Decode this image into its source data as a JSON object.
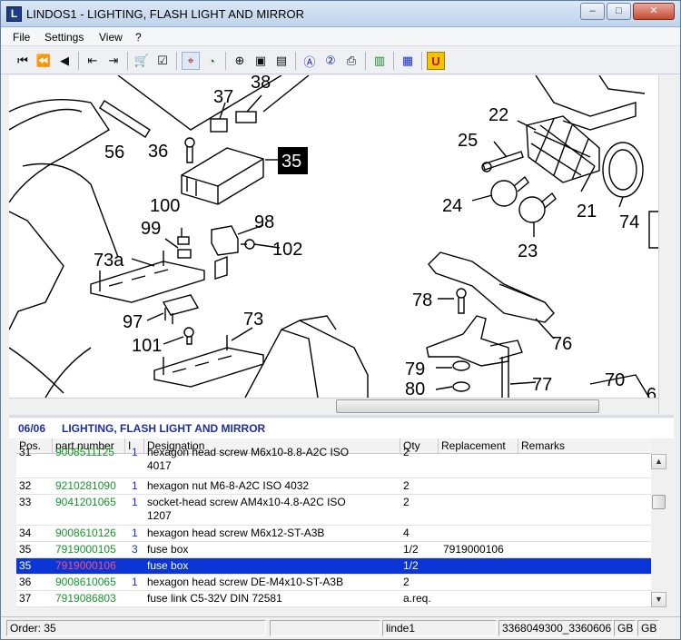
{
  "window": {
    "title": "LINDOS1 - LIGHTING, FLASH LIGHT AND MIRROR",
    "app_icon_glyph": "L",
    "minimize_glyph": "–",
    "maximize_glyph": "□",
    "close_glyph": "✕"
  },
  "menu": {
    "items": [
      "File",
      "Settings",
      "View",
      "?"
    ]
  },
  "toolbar": {
    "buttons": [
      {
        "icon": "first-page-icon",
        "glyph": "⏮"
      },
      {
        "icon": "fast-back-icon",
        "glyph": "⏪"
      },
      {
        "icon": "back-icon",
        "glyph": "◀"
      },
      {
        "icon": "jump-back-icon",
        "glyph": "⇤"
      },
      {
        "icon": "jump-forward-icon",
        "glyph": "⇥"
      },
      {
        "icon": "cart-icon",
        "glyph": "🛒"
      },
      {
        "icon": "order-list-icon",
        "glyph": "☑"
      },
      {
        "icon": "hotspot-icon",
        "glyph": "⌖"
      },
      {
        "icon": "chart-icon",
        "glyph": "◔"
      },
      {
        "icon": "zoom-icon",
        "glyph": "⊕"
      },
      {
        "icon": "fit-page-icon",
        "glyph": "▣"
      },
      {
        "icon": "fit-width-icon",
        "glyph": "▤"
      },
      {
        "icon": "find-a-icon",
        "glyph": "Ⓐ"
      },
      {
        "icon": "find-2-icon",
        "glyph": "②"
      },
      {
        "icon": "print-icon",
        "glyph": "⎙"
      },
      {
        "icon": "book-icon",
        "glyph": "▥"
      },
      {
        "icon": "grid-icon",
        "glyph": "▦"
      },
      {
        "icon": "u-icon",
        "glyph": "U"
      }
    ]
  },
  "drawing": {
    "callouts": [
      "37",
      "38",
      "56",
      "36",
      "35",
      "100",
      "99",
      "98",
      "102",
      "73a",
      "97",
      "101",
      "73",
      "22",
      "25",
      "24",
      "21",
      "74",
      "23",
      "78",
      "76",
      "79",
      "77",
      "80",
      "70",
      "6"
    ],
    "highlight": "35"
  },
  "parts": {
    "code": "06/06",
    "title": "LIGHTING, FLASH LIGHT AND MIRROR",
    "columns": [
      "Pos.",
      "part number",
      "I",
      "Designation",
      "Qty",
      "Replacement",
      "Remarks"
    ],
    "rows": [
      {
        "pos": "31",
        "part": "9008511125",
        "i": "1",
        "desc": [
          "hexagon head screw M6x10-8.8-A2C  ISO",
          "4017"
        ],
        "qty": "2",
        "repl": "",
        "remarks": ""
      },
      {
        "pos": "32",
        "part": "9210281090",
        "i": "1",
        "desc": [
          "hexagon nut M6-8-A2C  ISO 4032"
        ],
        "qty": "2",
        "repl": "",
        "remarks": ""
      },
      {
        "pos": "33",
        "part": "9041201065",
        "i": "1",
        "desc": [
          "socket-head screw AM4x10-4.8-A2C  ISO",
          "1207"
        ],
        "qty": "2",
        "repl": "",
        "remarks": ""
      },
      {
        "pos": "34",
        "part": "9008610126",
        "i": "1",
        "desc": [
          "hexagon head screw M6x12-ST-A3B"
        ],
        "qty": "4",
        "repl": "",
        "remarks": ""
      },
      {
        "pos": "35",
        "part": "7919000105",
        "i": "3",
        "desc": [
          "fuse box"
        ],
        "qty": "1/2",
        "repl": "7919000106",
        "remarks": ""
      },
      {
        "pos": "35",
        "part": "7919000106",
        "i": "",
        "desc": [
          "fuse box"
        ],
        "qty": "1/2",
        "repl": "",
        "remarks": "",
        "selected": true
      },
      {
        "pos": "36",
        "part": "9008610065",
        "i": "1",
        "desc": [
          "hexagon head screw DE-M4x10-ST-A3B"
        ],
        "qty": "2",
        "repl": "",
        "remarks": ""
      },
      {
        "pos": "37",
        "part": "7919086803",
        "i": "",
        "desc": [
          "fuse link C5-32V  DIN 72581"
        ],
        "qty": "a.req.",
        "repl": "",
        "remarks": ""
      }
    ]
  },
  "status": {
    "order": "Order: 35",
    "user": "linde1",
    "ids": "3368049300_3360606",
    "lang1": "GB",
    "lang2": "GB"
  },
  "colors": {
    "header_text": "#1e2f9e",
    "part_number": "#16962a",
    "index": "#1833d8",
    "selection": "#0a36d6",
    "selected_part": "#ff4d6b"
  }
}
